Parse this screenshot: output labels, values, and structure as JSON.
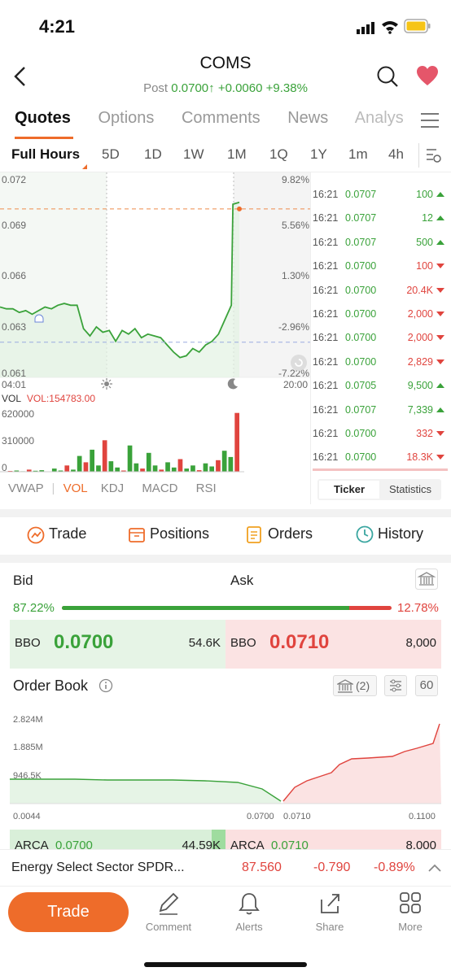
{
  "status": {
    "time": "4:21"
  },
  "header": {
    "symbol": "COMS",
    "session": "Post",
    "price": "0.0700",
    "arrow": "↑",
    "change": "+0.0060",
    "pct": "+9.38%"
  },
  "tabs": [
    "Quotes",
    "Options",
    "Comments",
    "News",
    "Analys"
  ],
  "ranges": [
    "Full Hours",
    "5D",
    "1D",
    "1W",
    "1M",
    "1Q",
    "1Y",
    "1m",
    "4h"
  ],
  "chart": {
    "y_labels": [
      "0.072",
      "0.069",
      "0.066",
      "0.063",
      "0.061"
    ],
    "pct_labels": [
      "9.82%",
      "5.56%",
      "1.30%",
      "-2.96%",
      "-7.22%"
    ],
    "t_start": "04:01",
    "t_end": "20:00",
    "vol_label": "VOL",
    "vol_value": "VOL:154783.00",
    "vol_ticks": [
      "620000",
      "310000",
      "0"
    ],
    "indicators": [
      "VWAP",
      "VOL",
      "KDJ",
      "MACD",
      "RSI"
    ]
  },
  "chart_data": {
    "type": "line",
    "title": "",
    "ylim": [
      0.061,
      0.072
    ],
    "x_range": [
      "04:01",
      "20:00"
    ],
    "series": [
      {
        "values": [
          0.0649,
          0.0648,
          0.0648,
          0.0646,
          0.0647,
          0.0645,
          0.0647,
          0.0649,
          0.0648,
          0.065,
          0.0651,
          0.065,
          0.065,
          0.0637,
          0.0633,
          0.0638,
          0.0635,
          0.0636,
          0.063,
          0.0636,
          0.0634,
          0.0637,
          0.0632,
          0.0634,
          0.0633,
          0.0632,
          0.0628,
          0.0624,
          0.0621,
          0.0622,
          0.0626,
          0.0624,
          0.0628,
          0.063,
          0.0634,
          0.0642,
          0.065,
          0.0706,
          0.0707
        ]
      }
    ],
    "volume": {
      "ylim": [
        0,
        620000
      ],
      "values": [
        0,
        8000,
        12000,
        5000,
        20000,
        9000,
        15000,
        4000,
        30000,
        12000,
        60000,
        20000,
        150000,
        90000,
        210000,
        60000,
        300000,
        100000,
        40000,
        12000,
        250000,
        80000,
        30000,
        180000,
        60000,
        20000,
        90000,
        40000,
        120000,
        30000,
        60000,
        15000,
        80000,
        50000,
        110000,
        200000,
        140000,
        560000
      ]
    }
  },
  "ticker": [
    {
      "time": "16:21",
      "price": "0.0707",
      "vol": "100",
      "dir": "up"
    },
    {
      "time": "16:21",
      "price": "0.0707",
      "vol": "12",
      "dir": "up"
    },
    {
      "time": "16:21",
      "price": "0.0707",
      "vol": "500",
      "dir": "up"
    },
    {
      "time": "16:21",
      "price": "0.0700",
      "vol": "100",
      "dir": "down"
    },
    {
      "time": "16:21",
      "price": "0.0700",
      "vol": "20.4K",
      "dir": "down"
    },
    {
      "time": "16:21",
      "price": "0.0700",
      "vol": "2,000",
      "dir": "down"
    },
    {
      "time": "16:21",
      "price": "0.0700",
      "vol": "2,000",
      "dir": "down"
    },
    {
      "time": "16:21",
      "price": "0.0700",
      "vol": "2,829",
      "dir": "down"
    },
    {
      "time": "16:21",
      "price": "0.0705",
      "vol": "9,500",
      "dir": "up"
    },
    {
      "time": "16:21",
      "price": "0.0707",
      "vol": "7,339",
      "dir": "up"
    },
    {
      "time": "16:21",
      "price": "0.0700",
      "vol": "332",
      "dir": "down"
    },
    {
      "time": "16:21",
      "price": "0.0700",
      "vol": "18.3K",
      "dir": "down"
    }
  ],
  "ticker_tabs": [
    "Ticker",
    "Statistics"
  ],
  "actions": [
    "Trade",
    "Positions",
    "Orders",
    "History"
  ],
  "bidask": {
    "bid": "Bid",
    "ask": "Ask",
    "bid_pct": "87.22%",
    "ask_pct": "12.78%",
    "bid_share": 0.8722,
    "bbo_label": "BBO",
    "bid_price": "0.0700",
    "bid_size": "54.6K",
    "ask_price": "0.0710",
    "ask_size": "8,000"
  },
  "orderbook": {
    "title": "Order Book",
    "exchanges": "(2)",
    "depth": "60",
    "y_labels": [
      "2.824M",
      "1.885M",
      "946.5K"
    ],
    "x_labels": [
      "0.0044",
      "0.0700",
      "0.0710",
      "0.1100"
    ],
    "row": {
      "bid_ex": "ARCA",
      "bid_price": "0.0700",
      "bid_size": "44.59K",
      "ask_ex": "ARCA",
      "ask_price": "0.0710",
      "ask_size": "8,000"
    }
  },
  "etf": {
    "name": "Energy Select Sector SPDR...",
    "price": "87.560",
    "change": "-0.790",
    "pct": "-0.89%"
  },
  "bottom": {
    "trade": "Trade",
    "items": [
      "Comment",
      "Alerts",
      "Share",
      "More"
    ]
  }
}
